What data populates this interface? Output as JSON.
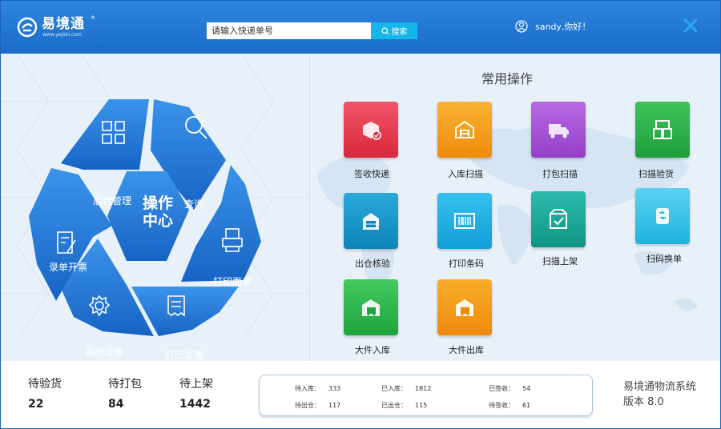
{
  "header": {
    "logo_name": "易境通",
    "logo_reg": "®",
    "logo_url": "www.yejoin.com",
    "search_placeholder": "请输入快递单号",
    "search_button": "搜索",
    "greeting": "sandy,你好！"
  },
  "ops_center": {
    "center_label_line1": "操作",
    "center_label_line2": "中心",
    "segments": [
      {
        "label": "后台管理",
        "icon": "grid-icon"
      },
      {
        "label": "查询",
        "icon": "search-icon"
      },
      {
        "label": "打印面单",
        "icon": "printer-icon"
      },
      {
        "label": "打印发票",
        "icon": "receipt-icon"
      },
      {
        "label": "系统设置",
        "icon": "gear-icon"
      },
      {
        "label": "录单开票",
        "icon": "form-edit-icon"
      }
    ]
  },
  "common_ops": {
    "title": "常用操作",
    "tiles": [
      {
        "label": "签收快递",
        "icon": "parcel-sign-icon",
        "color": "#e8394d"
      },
      {
        "label": "入库扫描",
        "icon": "warehouse-icon",
        "color": "#f49a17"
      },
      {
        "label": "打包扫描",
        "icon": "truck-icon",
        "color": "#a451d6"
      },
      {
        "label": "扫描验货",
        "icon": "inspect-boxes-icon",
        "color": "#27b24a"
      },
      {
        "label": "出仓核验",
        "icon": "outbound-check-icon",
        "color": "#1797c9"
      },
      {
        "label": "打印条码",
        "icon": "barcode-icon",
        "color": "#1fb0e4"
      },
      {
        "label": "扫描上架",
        "icon": "shelf-check-icon",
        "color": "#18a899"
      },
      {
        "label": "扫码换单",
        "icon": "scan-swap-icon",
        "color": "#35c3e6"
      },
      {
        "label": "大件入库",
        "icon": "large-inbound-icon",
        "color": "#2dbb4c"
      },
      {
        "label": "大件出库",
        "icon": "large-outbound-icon",
        "color": "#f39a12"
      }
    ]
  },
  "footer": {
    "stats": [
      {
        "label": "待验货",
        "value": "22"
      },
      {
        "label": "待打包",
        "value": "84"
      },
      {
        "label": "待上架",
        "value": "1442"
      }
    ],
    "summary": [
      {
        "label": "待入库：",
        "value": "333"
      },
      {
        "label": "已入库：",
        "value": "1812"
      },
      {
        "label": "已签收：",
        "value": "54"
      },
      {
        "label": "待出仓：",
        "value": "117"
      },
      {
        "label": "已出仓：",
        "value": "115"
      },
      {
        "label": "待签收：",
        "value": "61"
      }
    ],
    "system_name": "易境通物流系统",
    "version": "版本 8.0"
  }
}
